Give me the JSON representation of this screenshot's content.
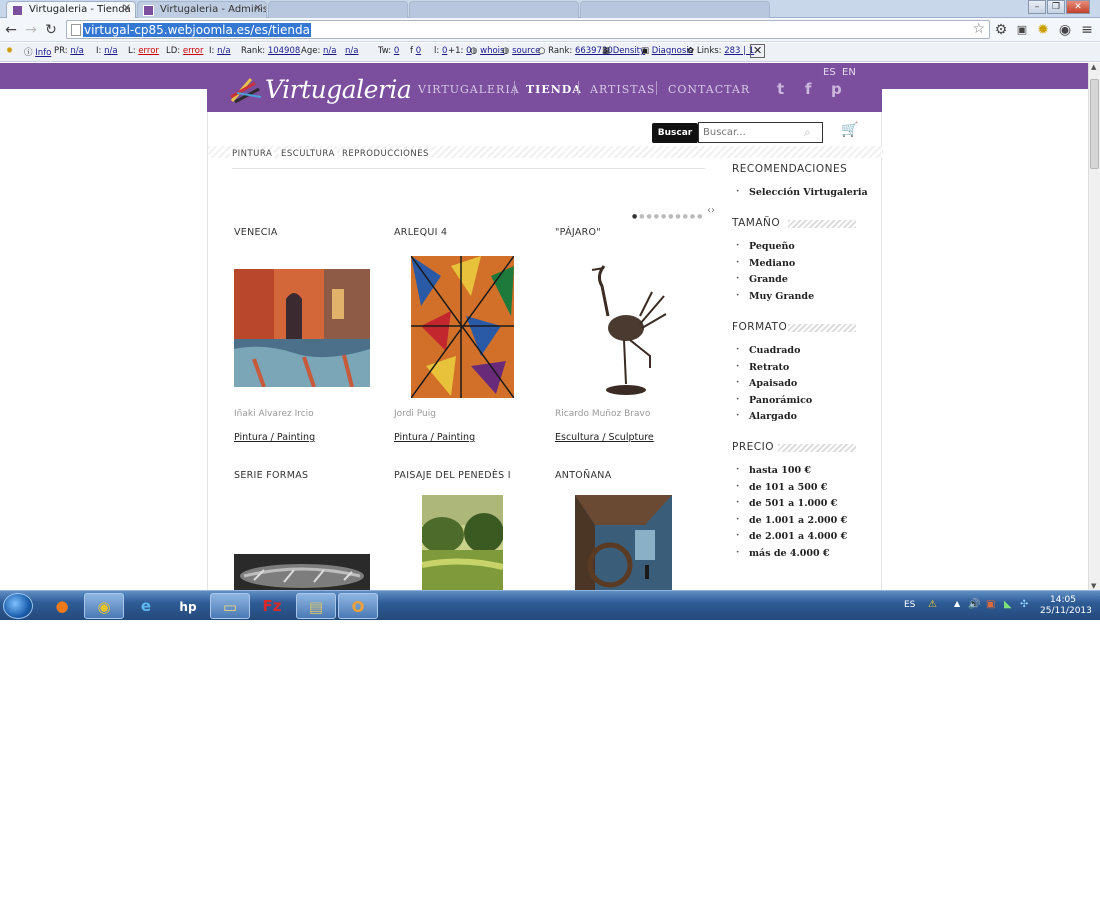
{
  "browser": {
    "tabs": [
      {
        "label": "Virtugaleria - Tienda",
        "state": "active"
      },
      {
        "label": "Virtugaleria - Administrac",
        "state": "inactive"
      },
      {
        "label": "",
        "state": "blurred"
      },
      {
        "label": "",
        "state": "blurred"
      },
      {
        "label": "",
        "state": "blurred"
      }
    ],
    "url": "virtugal-cp85.webjoomla.es/es/tienda"
  },
  "seo_toolbar": {
    "items": [
      {
        "label": "Info",
        "value": ""
      },
      {
        "label": "PR:",
        "value": "n/a"
      },
      {
        "label": "I:",
        "value": "n/a"
      },
      {
        "label": "L:",
        "value": "error"
      },
      {
        "label": "LD:",
        "value": "error"
      },
      {
        "label": "I:",
        "value": "n/a"
      },
      {
        "label": "Rank:",
        "value": "104908"
      },
      {
        "label": "Age:",
        "value": "n/a"
      },
      {
        "label": "",
        "value": "n/a"
      },
      {
        "label": "Tw:",
        "value": "0"
      },
      {
        "label": "f",
        "value": "0"
      },
      {
        "label": "l:",
        "value": "0"
      },
      {
        "label": "+1:",
        "value": "0"
      },
      {
        "label": "",
        "value": "whois"
      },
      {
        "label": "",
        "value": "source"
      },
      {
        "label": "Rank:",
        "value": "6639730"
      },
      {
        "label": "",
        "value": "Density"
      },
      {
        "label": "",
        "value": "Diagnosis"
      },
      {
        "label": "Links:",
        "value": "283 | 1"
      }
    ]
  },
  "site": {
    "logo_text": "Virtugaleria",
    "nav": [
      "VIRTUGALERIA",
      "TIENDA",
      "ARTISTAS",
      "CONTACTAR"
    ],
    "active_nav": "TIENDA",
    "languages": [
      "ES",
      "EN"
    ],
    "social": {
      "twitter": "t",
      "facebook": "f",
      "pinterest": "p"
    },
    "search": {
      "button": "Buscar",
      "placeholder": "Buscar..."
    },
    "categories": [
      "PINTURA",
      "ESCULTURA",
      "REPRODUCCIONES"
    ],
    "slider": {
      "dots_total": 10,
      "current": 1,
      "arrows": "‹›"
    },
    "products": [
      {
        "title": "VENECIA",
        "artist": "Iñaki Alvarez Ircio",
        "category": "Pintura / Painting"
      },
      {
        "title": "ARLEQUI 4",
        "artist": "Jordi Puig",
        "category": "Pintura / Painting"
      },
      {
        "title": "\"PÁJARO\"",
        "artist": "Ricardo Muñoz Bravo",
        "category": "Escultura / Sculpture"
      },
      {
        "title": "SERIE FORMAS",
        "artist": "",
        "category": ""
      },
      {
        "title": "PAISAJE DEL PENEDÈS I",
        "artist": "",
        "category": ""
      },
      {
        "title": "ANTOÑANA",
        "artist": "",
        "category": ""
      }
    ],
    "sidebar": {
      "sections": [
        {
          "heading": "RECOMENDACIONES",
          "items": [
            "Selección Virtugaleria"
          ]
        },
        {
          "heading": "TAMAÑO",
          "items": [
            "Pequeño",
            "Mediano",
            "Grande",
            "Muy Grande"
          ]
        },
        {
          "heading": "FORMATO",
          "items": [
            "Cuadrado",
            "Retrato",
            "Apaisado",
            "Panorámico",
            "Alargado"
          ]
        },
        {
          "heading": "PRECIO",
          "items": [
            "hasta 100 €",
            "de 101 a 500 €",
            "de 501 a 1.000 €",
            "de 1.001 a 2.000 €",
            "de 2.001 a 4.000 €",
            "más de 4.000 €"
          ]
        }
      ]
    },
    "colors": {
      "brand_purple": "#7b4f9e",
      "text": "#222222"
    }
  },
  "taskbar": {
    "apps": [
      "firefox-icon",
      "chrome-icon",
      "internet-explorer-icon",
      "hp-icon",
      "explorer-folder-icon",
      "filezilla-icon",
      "archive-icon",
      "outlook-icon"
    ],
    "language": "ES",
    "time": "14:05",
    "date": "25/11/2013"
  }
}
